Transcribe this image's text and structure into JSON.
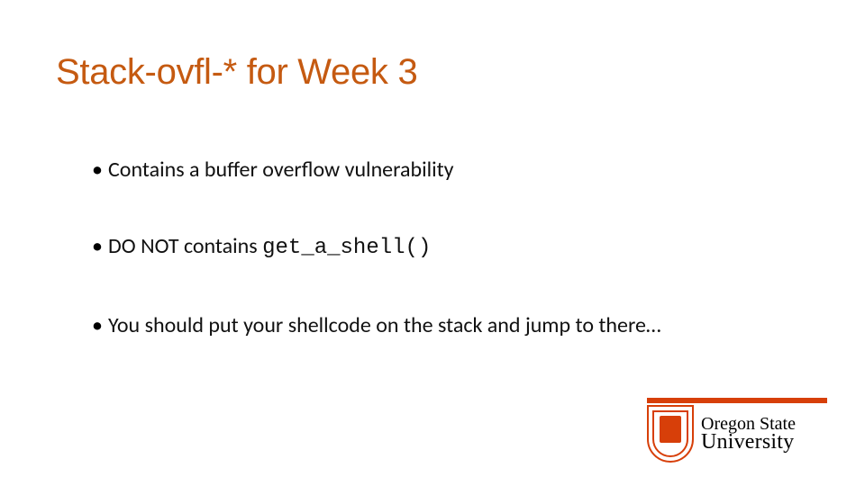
{
  "title": {
    "prefix": "Stack-",
    "ovfl": "ovfl",
    "dash": "-* for Week 3"
  },
  "bullets": [
    {
      "text": "Contains a buffer overflow vulnerability"
    },
    {
      "prefix": "DO NOT contains ",
      "code": "get_a_shell()"
    },
    {
      "text": "You should put your shellcode on the stack and jump to there…"
    }
  ],
  "logo": {
    "line1": "Oregon State",
    "line2": "University"
  }
}
